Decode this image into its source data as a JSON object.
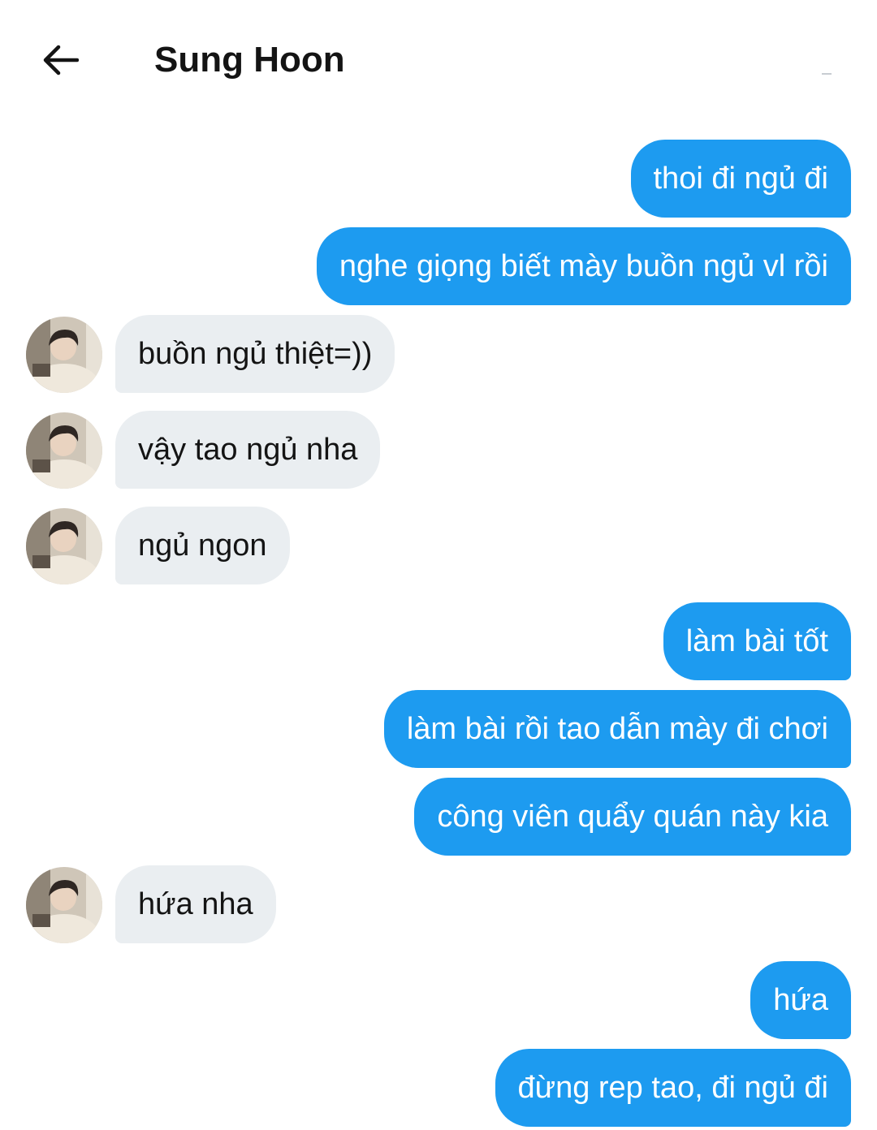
{
  "header": {
    "title": "Sung Hoon",
    "back_icon": "arrow-left-icon"
  },
  "colors": {
    "sent_bubble": "#1d9bf0",
    "received_bubble": "#eaeef1",
    "sent_text": "#ffffff",
    "received_text": "#141414"
  },
  "messages": [
    {
      "from": "me",
      "text": "thoi đi ngủ đi"
    },
    {
      "from": "me",
      "text": "nghe giọng biết mày buồn ngủ vl rồi"
    },
    {
      "from": "them",
      "text": "buồn ngủ thiệt=))"
    },
    {
      "from": "them",
      "text": "vậy tao ngủ nha"
    },
    {
      "from": "them",
      "text": "ngủ ngon"
    },
    {
      "from": "me",
      "text": "làm bài tốt"
    },
    {
      "from": "me",
      "text": "làm bài rồi tao dẫn mày đi chơi"
    },
    {
      "from": "me",
      "text": "công viên quẩy quán này kia"
    },
    {
      "from": "them",
      "text": "hứa nha"
    },
    {
      "from": "me",
      "text": "hứa"
    },
    {
      "from": "me",
      "text": "đừng rep tao, đi ngủ đi"
    }
  ]
}
